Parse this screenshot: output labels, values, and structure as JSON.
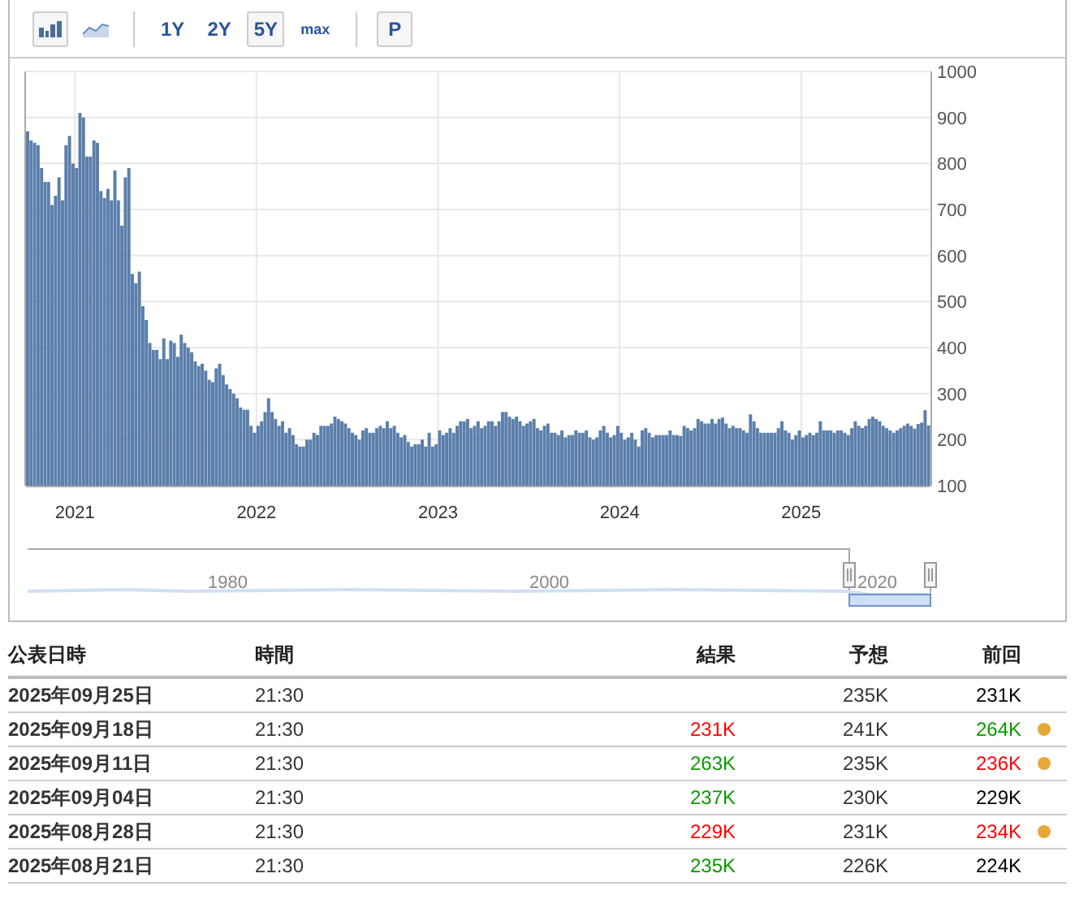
{
  "toolbar": {
    "chart_types": [
      {
        "kind": "bar",
        "selected": true
      },
      {
        "kind": "area",
        "selected": false
      }
    ],
    "ranges": [
      {
        "label": "1Y",
        "selected": false
      },
      {
        "label": "2Y",
        "selected": false
      },
      {
        "label": "5Y",
        "selected": true
      },
      {
        "label": "max",
        "selected": false
      }
    ],
    "extra_button": "P"
  },
  "chart_data": {
    "type": "bar",
    "grid": true,
    "ylim": [
      100,
      1000
    ],
    "yticks": [
      100,
      200,
      300,
      400,
      500,
      600,
      700,
      800,
      900,
      1000
    ],
    "series": [
      {
        "color": "#5b7fab",
        "values": [
          870,
          850,
          845,
          840,
          790,
          760,
          760,
          710,
          730,
          770,
          720,
          840,
          860,
          800,
          790,
          910,
          900,
          815,
          815,
          850,
          845,
          740,
          725,
          745,
          720,
          785,
          720,
          665,
          770,
          790,
          560,
          540,
          565,
          490,
          460,
          410,
          395,
          395,
          375,
          420,
          375,
          415,
          410,
          380,
          428,
          410,
          400,
          390,
          370,
          360,
          365,
          350,
          330,
          325,
          355,
          365,
          340,
          320,
          310,
          300,
          290,
          270,
          265,
          265,
          230,
          215,
          230,
          240,
          260,
          290,
          260,
          245,
          230,
          240,
          215,
          225,
          210,
          190,
          185,
          185,
          200,
          200,
          215,
          210,
          230,
          230,
          230,
          235,
          250,
          245,
          240,
          235,
          225,
          215,
          210,
          200,
          220,
          225,
          215,
          215,
          225,
          230,
          225,
          240,
          225,
          230,
          215,
          205,
          210,
          195,
          185,
          190,
          190,
          200,
          185,
          215,
          185,
          190,
          220,
          210,
          215,
          225,
          215,
          230,
          240,
          240,
          245,
          225,
          230,
          240,
          225,
          230,
          240,
          240,
          230,
          240,
          260,
          260,
          250,
          245,
          250,
          240,
          230,
          235,
          240,
          245,
          225,
          220,
          230,
          235,
          215,
          215,
          210,
          220,
          205,
          210,
          210,
          220,
          215,
          215,
          220,
          205,
          200,
          205,
          220,
          230,
          215,
          205,
          210,
          230,
          215,
          200,
          205,
          215,
          200,
          185,
          220,
          225,
          215,
          205,
          210,
          210,
          210,
          210,
          220,
          210,
          210,
          208,
          230,
          225,
          220,
          225,
          245,
          240,
          235,
          235,
          245,
          235,
          245,
          248,
          235,
          225,
          230,
          225,
          225,
          220,
          215,
          255,
          240,
          225,
          215,
          215,
          215,
          215,
          215,
          225,
          240,
          220,
          215,
          200,
          210,
          220,
          205,
          210,
          215,
          210,
          215,
          240,
          220,
          220,
          220,
          215,
          220,
          220,
          215,
          210,
          225,
          240,
          230,
          225,
          230,
          245,
          250,
          245,
          240,
          230,
          225,
          220,
          215,
          220,
          225,
          230,
          235,
          230,
          224,
          234,
          237,
          264,
          231
        ]
      }
    ]
  },
  "x_axis_labels": [
    "2021",
    "2022",
    "2023",
    "2024",
    "2025"
  ],
  "navigator": {
    "labels": [
      "1980",
      "2000",
      "2020"
    ]
  },
  "table": {
    "columns": [
      "公表日時",
      "時間",
      "結果",
      "予想",
      "前回"
    ],
    "rows": [
      {
        "date": "2025年09月25日",
        "time": "21:30",
        "forecast": "235K",
        "previous": {
          "text": "231K",
          "color": "#000000"
        },
        "revised": false
      },
      {
        "date": "2025年09月18日",
        "time": "21:30",
        "actual": {
          "text": "231K",
          "color": "#ff0000"
        },
        "forecast": "241K",
        "previous": {
          "text": "264K",
          "color": "#0a9900"
        },
        "revised": true
      },
      {
        "date": "2025年09月11日",
        "time": "21:30",
        "actual": {
          "text": "263K",
          "color": "#0a9900"
        },
        "forecast": "235K",
        "previous": {
          "text": "236K",
          "color": "#ff0000"
        },
        "revised": true
      },
      {
        "date": "2025年09月04日",
        "time": "21:30",
        "actual": {
          "text": "237K",
          "color": "#0a9900"
        },
        "forecast": "230K",
        "previous": {
          "text": "229K",
          "color": "#000000"
        },
        "revised": false
      },
      {
        "date": "2025年08月28日",
        "time": "21:30",
        "actual": {
          "text": "229K",
          "color": "#ff0000"
        },
        "forecast": "231K",
        "previous": {
          "text": "234K",
          "color": "#ff0000"
        },
        "revised": true
      },
      {
        "date": "2025年08月21日",
        "time": "21:30",
        "actual": {
          "text": "235K",
          "color": "#0a9900"
        },
        "forecast": "226K",
        "previous": {
          "text": "224K",
          "color": "#000000"
        },
        "revised": false
      }
    ]
  }
}
